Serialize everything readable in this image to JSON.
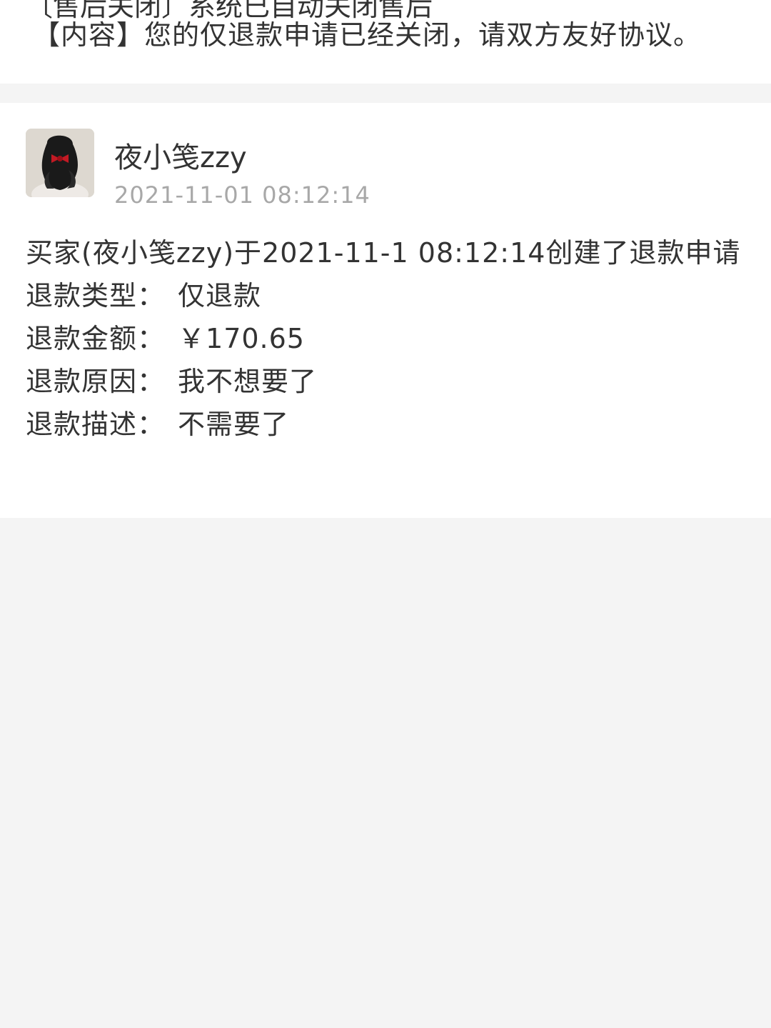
{
  "top_notice": {
    "partial_previous_line": "〔售后关闭〕系统已自动关闭售后",
    "content_line": "【内容】您的仅退款申请已经关闭，请双方友好协议。"
  },
  "record": {
    "avatar": "avatar-photo",
    "user_name": "夜小笺zzy",
    "timestamp": "2021-11-01 08:12:14",
    "summary": "买家(夜小笺zzy)于2021-11-1 08:12:14创建了退款申请",
    "fields": [
      {
        "label": "退款类型：",
        "value": "仅退款"
      },
      {
        "label": "退款金额：",
        "value": "￥170.65"
      },
      {
        "label": "退款原因：",
        "value": "我不想要了"
      },
      {
        "label": "退款描述：",
        "value": "不需要了"
      }
    ]
  }
}
